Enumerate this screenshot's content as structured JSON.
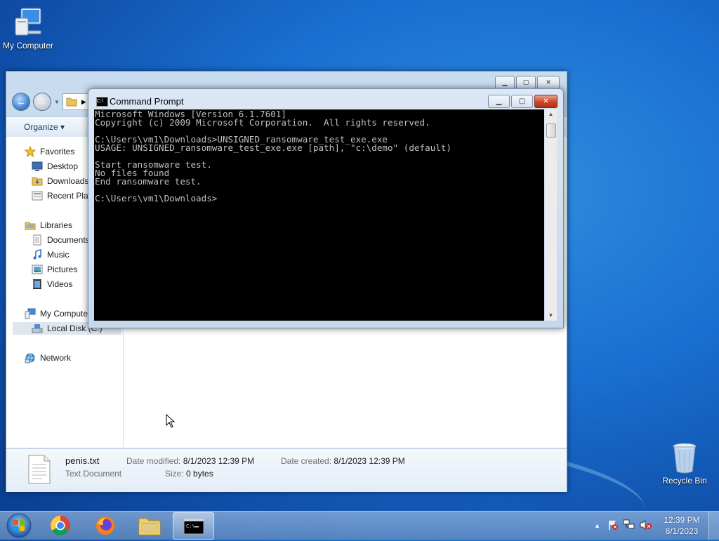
{
  "desktop": {
    "icons": [
      {
        "label": "My Computer",
        "icon": "computer-icon"
      },
      {
        "label": "Recycle Bin",
        "icon": "recycle-bin-icon"
      }
    ]
  },
  "explorer": {
    "toolbar": {
      "organize_label": "Organize ▾"
    },
    "nav": {
      "favorites": "Favorites",
      "desktop": "Desktop",
      "downloads": "Downloads",
      "recent_places": "Recent Places",
      "libraries": "Libraries",
      "documents": "Documents",
      "music": "Music",
      "pictures": "Pictures",
      "videos": "Videos",
      "my_computer": "My Computer",
      "local_disk": "Local Disk (C:)",
      "network": "Network"
    },
    "details": {
      "file_name": "penis.txt",
      "file_type": "Text Document",
      "date_modified_label": "Date modified:",
      "date_modified": "8/1/2023 12:39 PM",
      "date_created_label": "Date created:",
      "date_created": "8/1/2023 12:39 PM",
      "size_label": "Size:",
      "size": "0 bytes"
    }
  },
  "cmd": {
    "title": "Command Prompt",
    "output": "Microsoft Windows [Version 6.1.7601]\nCopyright (c) 2009 Microsoft Corporation.  All rights reserved.\n\nC:\\Users\\vm1\\Downloads>UNSIGNED_ransomware_test_exe.exe\nUSAGE: UNSIGNED_ransomware_test_exe.exe [path], \"c:\\demo\" (default)\n\nStart ransomware test.\nNo files found\nEnd ransomware test.\n\nC:\\Users\\vm1\\Downloads>"
  },
  "taskbar": {
    "apps": [
      "start-button",
      "chrome",
      "firefox",
      "file-explorer",
      "command-prompt"
    ],
    "clock_time": "12:39 PM",
    "clock_date": "8/1/2023"
  }
}
